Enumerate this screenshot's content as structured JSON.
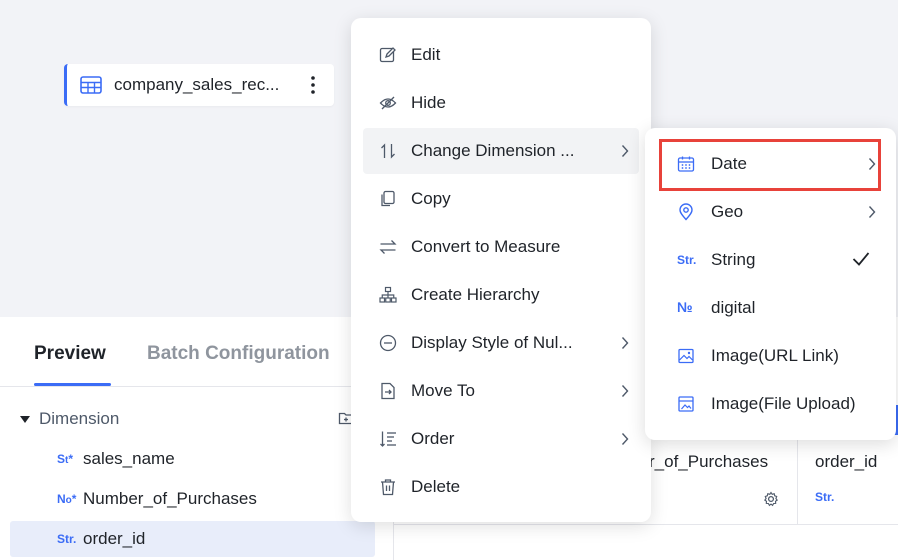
{
  "canvas": {
    "table_name": "company_sales_rec..."
  },
  "panel": {
    "tabs": [
      "Preview",
      "Batch Configuration"
    ],
    "dimension_label": "Dimension",
    "fields": [
      {
        "type": "Str.",
        "name": "sales_name"
      },
      {
        "type": "No.",
        "name": "Number_of_Purchases"
      },
      {
        "type": "Str.",
        "name": "order_id"
      }
    ]
  },
  "grid": {
    "columns": [
      "r_of_Purchases",
      "order_id"
    ],
    "order_id_type": "Str."
  },
  "context_menu": {
    "items": [
      {
        "label": "Edit",
        "icon": "edit-icon"
      },
      {
        "label": "Hide",
        "icon": "hide-eye-icon"
      },
      {
        "label": "Change Dimension ...",
        "icon": "swap-vertical-icon",
        "submenu": true
      },
      {
        "label": "Copy",
        "icon": "copy-icon"
      },
      {
        "label": "Convert to Measure",
        "icon": "convert-arrows-icon"
      },
      {
        "label": "Create Hierarchy",
        "icon": "hierarchy-icon"
      },
      {
        "label": "Display Style of Nul...",
        "icon": "null-style-icon",
        "submenu": true
      },
      {
        "label": "Move To",
        "icon": "move-to-icon",
        "submenu": true
      },
      {
        "label": "Order",
        "icon": "order-icon",
        "submenu": true
      },
      {
        "label": "Delete",
        "icon": "trash-icon"
      }
    ]
  },
  "dimension_submenu": {
    "items": [
      {
        "label": "Date",
        "icon": "calendar-icon",
        "submenu": true
      },
      {
        "label": "Geo",
        "icon": "location-pin-icon",
        "submenu": true
      },
      {
        "label": "String",
        "icon_text": "Str.",
        "checked": true
      },
      {
        "label": "digital",
        "icon_text": "№"
      },
      {
        "label": "Image(URL Link)",
        "icon": "image-icon"
      },
      {
        "label": "Image(File Upload)",
        "icon": "image-upload-icon"
      }
    ]
  },
  "colors": {
    "accent": "#3b6cf6",
    "highlight": "#e8423a"
  }
}
